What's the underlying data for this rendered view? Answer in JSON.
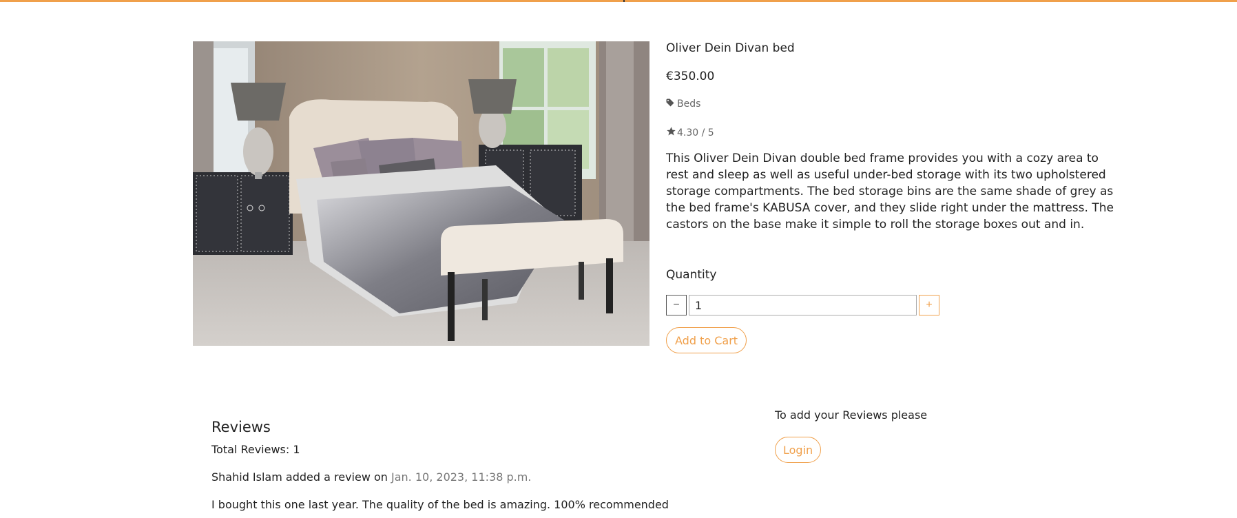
{
  "product": {
    "title": "Oliver Dein Divan bed",
    "price": "€350.00",
    "category": "Beds",
    "rating": "4.30 / 5",
    "description": "This Oliver Dein Divan double bed frame provides you with a cozy area to rest and sleep as well as useful under-bed storage with its two upholstered storage compartments. The bed storage bins are the same shade of grey as the bed frame's KABUSA cover, and they slide right under the mattress. The castors on the base make it simple to roll the storage boxes out and in.",
    "image_icon": "bedroom-photo"
  },
  "quantity": {
    "label": "Quantity",
    "value": "1",
    "minus_symbol": "−",
    "plus_symbol": "+"
  },
  "cart": {
    "add_label": "Add to Cart"
  },
  "reviews": {
    "heading": "Reviews",
    "total": "Total Reviews: 1",
    "items": [
      {
        "author_line": "Shahid Islam added a review on ",
        "date": "Jan. 10, 2023, 11:38 p.m.",
        "text": "I bought this one last year. The quality of the bed is amazing. 100% recommended"
      }
    ]
  },
  "login": {
    "prompt": "To add your Reviews please",
    "button_label": "Login"
  },
  "colors": {
    "accent": "#f0a04b",
    "text": "#222222",
    "muted": "#666666"
  },
  "icons": {
    "category": "tag-icon",
    "rating": "star-icon"
  }
}
